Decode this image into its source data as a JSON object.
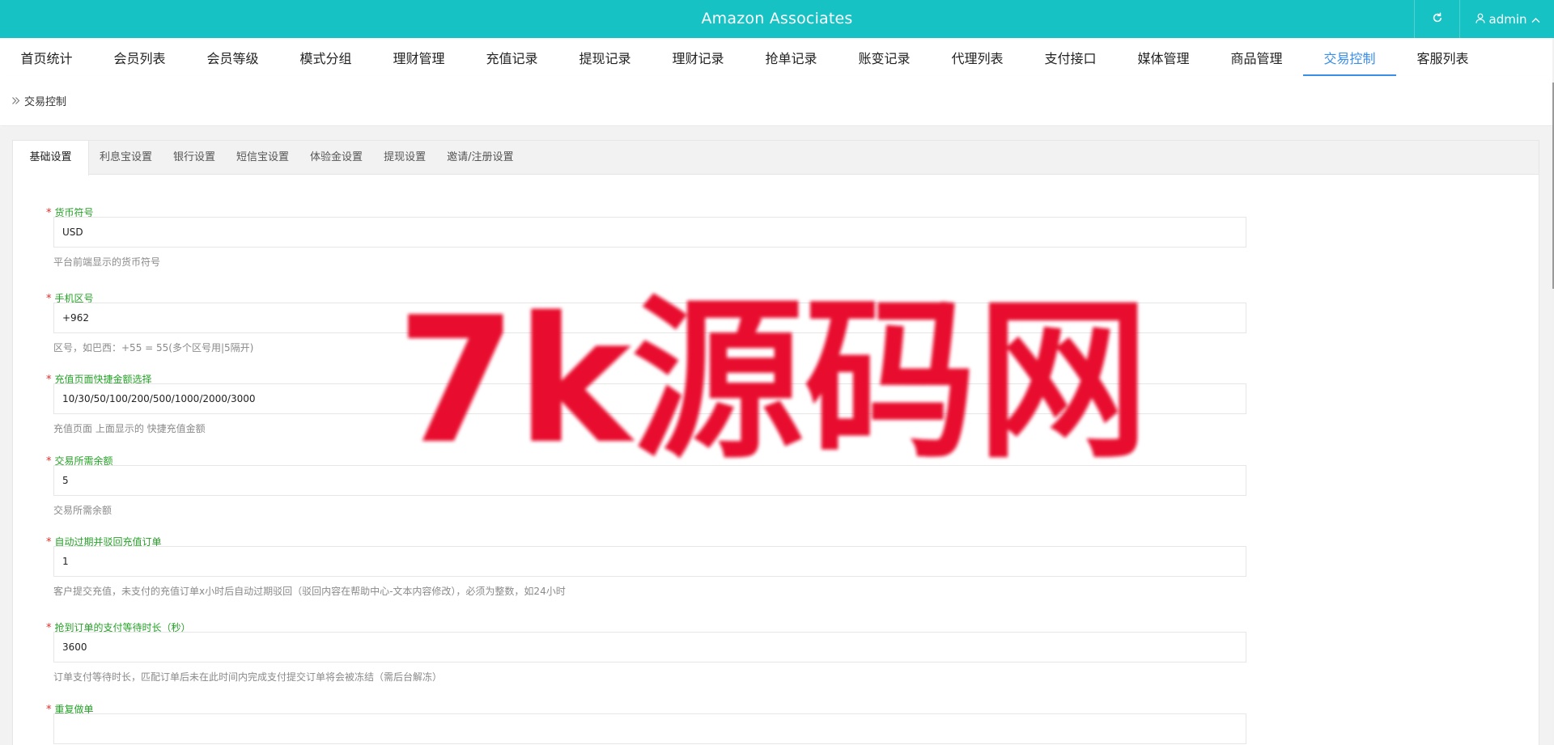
{
  "header": {
    "title": "Amazon Associates",
    "user": "admin",
    "brand_color": "#16c2c3"
  },
  "nav": {
    "items": [
      "首页统计",
      "会员列表",
      "会员等级",
      "模式分组",
      "理财管理",
      "充值记录",
      "提现记录",
      "理财记录",
      "抢单记录",
      "账变记录",
      "代理列表",
      "支付接口",
      "媒体管理",
      "商品管理",
      "交易控制",
      "客服列表"
    ],
    "active": "交易控制"
  },
  "breadcrumb": {
    "current": "交易控制"
  },
  "tabs": {
    "items": [
      "基础设置",
      "利息宝设置",
      "银行设置",
      "短信宝设置",
      "体验金设置",
      "提现设置",
      "邀请/注册设置"
    ],
    "active": "基础设置"
  },
  "form": {
    "fields": [
      {
        "label": "货币符号",
        "required": true,
        "value": "USD",
        "hint": "平台前端显示的货币符号"
      },
      {
        "label": "手机区号",
        "required": true,
        "value": "+962",
        "hint": "区号，如巴西：+55 = 55(多个区号用|5隔开)"
      },
      {
        "label": "充值页面快捷金额选择",
        "required": true,
        "value": "10/30/50/100/200/500/1000/2000/3000",
        "hint": "充值页面 上面显示的 快捷充值金额"
      },
      {
        "label": "交易所需余额",
        "required": true,
        "value": "5",
        "hint": "交易所需余额"
      },
      {
        "label": "自动过期并驳回充值订单",
        "required": true,
        "value": "1",
        "hint": "客户提交充值，未支付的充值订单x小时后自动过期驳回（驳回内容在帮助中心-文本内容修改），必须为整数，如24小时"
      },
      {
        "label": "抢到订单的支付等待时长（秒）",
        "required": true,
        "value": "3600",
        "hint": "订单支付等待时长，匹配订单后未在此时间内完成支付提交订单将会被冻结（需后台解冻）"
      },
      {
        "label": "重复做单",
        "required": true,
        "value": "",
        "hint": ""
      }
    ]
  },
  "watermark": {
    "text": "7k源码网",
    "color": "#e8102d"
  },
  "icons": {
    "refresh": "refresh-icon",
    "user": "user-icon",
    "chevron": "chevron-up-icon",
    "breadcrumb": "double-chevron-right-icon"
  }
}
